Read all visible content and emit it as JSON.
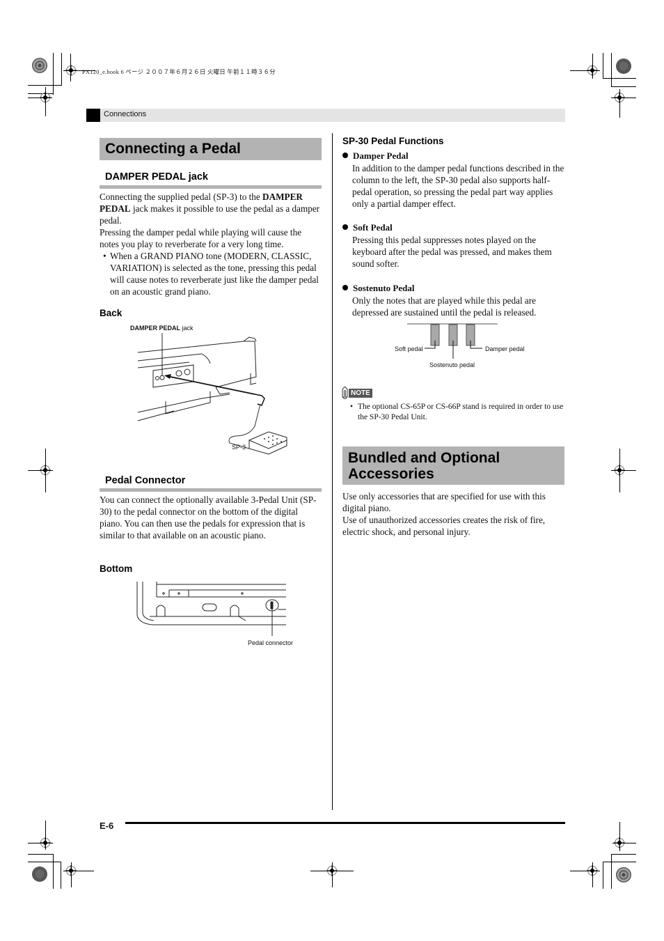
{
  "print_header": "PX120_e.book  6 ページ  ２００７年６月２６日  火曜日  午前１１時３６分",
  "section": {
    "label": "Connections"
  },
  "left_column": {
    "title": "Connecting a Pedal",
    "damper_jack": {
      "heading": "DAMPER PEDAL jack",
      "para1_pre": "Connecting the supplied pedal (SP-3) to the ",
      "para1_bold1": "DAMPER",
      "para1_bold2": "PEDAL",
      "para1_post": " jack makes it possible to use the pedal as a damper pedal.",
      "para2": "Pressing the damper pedal while playing will cause the notes you play to reverberate for a very long time.",
      "bullet": "When a GRAND PIANO tone (MODERN, CLASSIC, VARIATION) is selected as the tone, pressing this pedal will cause notes to reverberate just like the damper pedal on an acoustic grand piano."
    },
    "back_figure": {
      "heading": "Back",
      "jack_label_bold": "DAMPER PEDAL",
      "jack_label_rest": " jack",
      "pedal_label": "SP-3"
    },
    "pedal_connector": {
      "heading": "Pedal Connector",
      "para": "You can connect the optionally available 3-Pedal Unit (SP-30) to the pedal connector on the bottom of the digital piano. You can then use the pedals for expression that is similar to that available on an acoustic piano."
    },
    "bottom_figure": {
      "heading": "Bottom",
      "connector_label": "Pedal connector"
    }
  },
  "right_column": {
    "functions_heading": "SP-30 Pedal Functions",
    "functions": [
      {
        "title": "Damper Pedal",
        "text": "In addition to the damper pedal functions described in the column to the left, the SP-30 pedal also supports half-pedal operation, so pressing the pedal part way applies only a partial damper effect."
      },
      {
        "title": "Soft Pedal",
        "text": "Pressing this pedal suppresses notes played on the keyboard after the pedal was pressed, and makes them sound softer."
      },
      {
        "title": "Sostenuto Pedal",
        "text": "Only the notes that are played while this pedal are depressed are sustained until the pedal is released."
      }
    ],
    "pedal_diagram": {
      "soft": "Soft pedal",
      "sostenuto": "Sostenuto pedal",
      "damper": "Damper pedal"
    },
    "note": {
      "label": "NOTE",
      "text": "The optional CS-65P or CS-66P stand is required in order to use the SP-30 Pedal Unit."
    },
    "accessories": {
      "title_line1": "Bundled and Optional",
      "title_line2": "Accessories",
      "para1": "Use only accessories that are specified for use with this digital piano.",
      "para2": "Use of unauthorized accessories creates the risk of fire, electric shock, and personal injury."
    }
  },
  "footer": {
    "page_number": "E-6"
  }
}
